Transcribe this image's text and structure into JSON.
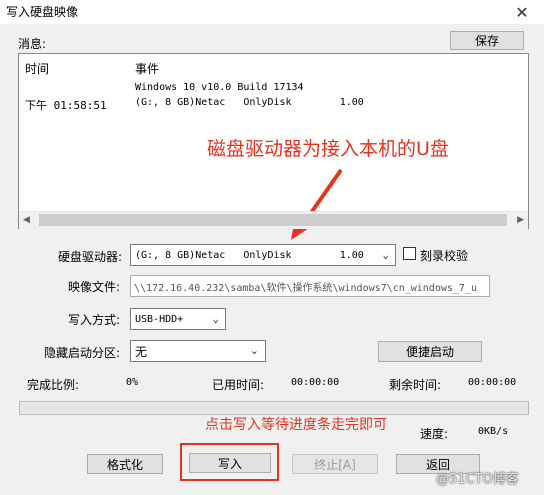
{
  "window": {
    "title": "写入硬盘映像",
    "close_glyph": "✕"
  },
  "messages": {
    "label": "消息:",
    "save_label": "保存",
    "columns": [
      "时间",
      "事件"
    ],
    "rows": [
      {
        "time": "",
        "event": "Windows 10 v10.0 Build 17134"
      },
      {
        "time": "下午 01:58:51",
        "event": "(G:, 8 GB)Netac   OnlyDisk        1.00"
      }
    ]
  },
  "annotations": {
    "drive_note": "磁盘驱动器为接入本机的U盘",
    "write_note": "点击写入等待进度条走完即可",
    "accent_color": "#e8321e"
  },
  "drive": {
    "label": "硬盘驱动器:",
    "value": "(G:, 8 GB)Netac   OnlyDisk        1.00",
    "verify_label": "刻录校验"
  },
  "image_file": {
    "label": "映像文件:",
    "value": "\\\\172.16.40.232\\samba\\软件\\操作系统\\windows7\\cn_windows_7_u"
  },
  "write_mode": {
    "label": "写入方式:",
    "value": "USB-HDD+"
  },
  "hidden_partition": {
    "label": "隐藏启动分区:",
    "value": "无"
  },
  "quick_boot_label": "便捷启动",
  "stats": {
    "ratio_label": "完成比例:",
    "ratio_value": "0%",
    "elapsed_label": "已用时间:",
    "elapsed_value": "00:00:00",
    "remaining_label": "剩余时间:",
    "remaining_value": "00:00:00",
    "speed_label": "速度:",
    "speed_value": "0KB/s",
    "progress": 0
  },
  "buttons": {
    "format": "格式化",
    "write": "写入",
    "stop": "终止[A]",
    "back": "返回"
  },
  "watermark": "@51CTO博客"
}
